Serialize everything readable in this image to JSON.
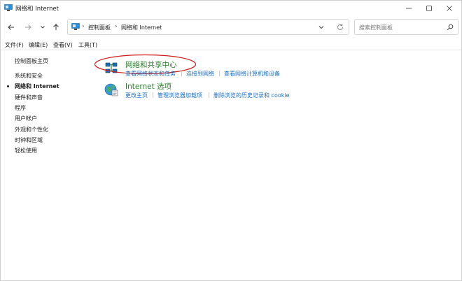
{
  "window": {
    "title": "网络和 Internet"
  },
  "address": {
    "crumbs": [
      "控制面板",
      "网络和 Internet"
    ],
    "separator": "›"
  },
  "search": {
    "placeholder": "搜索控制面板"
  },
  "menu": {
    "items": [
      "文件(F)",
      "编辑(E)",
      "查看(V)",
      "工具(T)"
    ]
  },
  "sidebar": {
    "home": "控制面板主页",
    "items": [
      "系统和安全",
      "网络和 Internet",
      "硬件和声音",
      "程序",
      "用户帐户",
      "外观和个性化",
      "时钟和区域",
      "轻松使用"
    ],
    "active_index": 1
  },
  "categories": [
    {
      "title": "网络和共享中心",
      "icon": "network-sharing-icon",
      "links": [
        "查看网络状态和任务",
        "连接到网络",
        "查看网络计算机和设备"
      ]
    },
    {
      "title": "Internet 选项",
      "icon": "internet-options-icon",
      "links": [
        "更改主页",
        "管理浏览器加载项",
        "删除浏览的历史记录和 cookie"
      ]
    }
  ],
  "colors": {
    "category_title": "#2c7e2c",
    "link": "#1a6ec4",
    "highlight": "#d11a1a"
  }
}
